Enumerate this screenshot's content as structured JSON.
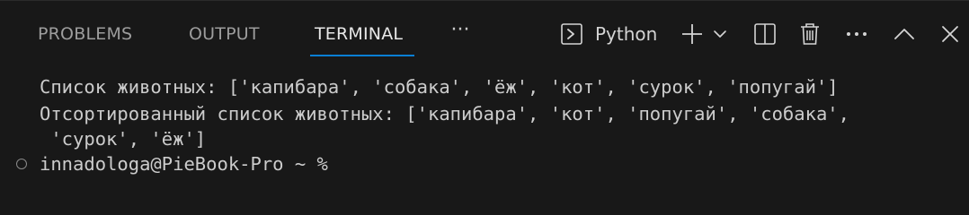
{
  "tabs": [
    {
      "label": "PROBLEMS",
      "active": false
    },
    {
      "label": "OUTPUT",
      "active": false
    },
    {
      "label": "TERMINAL",
      "active": true
    }
  ],
  "toolbar": {
    "more_tabs_label": "···",
    "terminal_profile_label": "Python",
    "icons": [
      "terminal-icon",
      "plus-icon",
      "chevron-down-icon",
      "split-icon",
      "trash-icon",
      "ellipsis-icon",
      "chevron-up-icon",
      "close-icon"
    ]
  },
  "terminal": {
    "lines": [
      "Список животных: ['капибара', 'собака', 'ёж', 'кот', 'сурок', 'попугай']",
      "Отсортированный список животных: ['капибара', 'кот', 'попугай', 'собака',",
      " 'сурок', 'ёж']"
    ],
    "prompt": "innadologa@PieBook-Pro ~ %"
  },
  "colors": {
    "background": "#181818",
    "accent": "#0a7fd4",
    "text": "#cccccc",
    "inactive_tab": "#9d9d9d"
  }
}
